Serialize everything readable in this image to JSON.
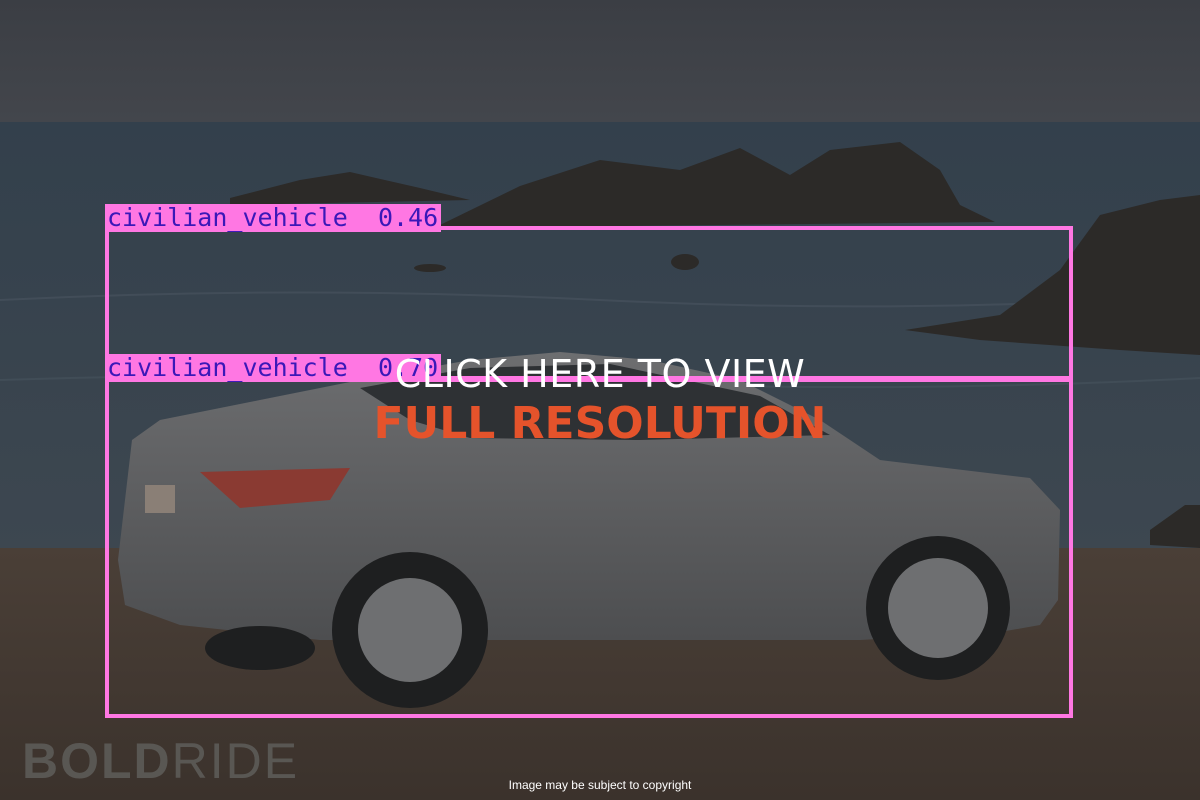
{
  "detections": [
    {
      "label": "civilian_vehicle",
      "score": "0.46"
    },
    {
      "label": "civilian_vehicle",
      "score": "0.70"
    }
  ],
  "overlay": {
    "line1": "CLICK HERE TO VIEW",
    "line2": "FULL RESOLUTION"
  },
  "watermark": {
    "bold": "BOLD",
    "light": "RIDE"
  },
  "copyright": "Image may be subject to copyright",
  "colors": {
    "box": "#ff77e3",
    "label_text": "#3b18b8",
    "cta_accent": "#e5532b"
  }
}
